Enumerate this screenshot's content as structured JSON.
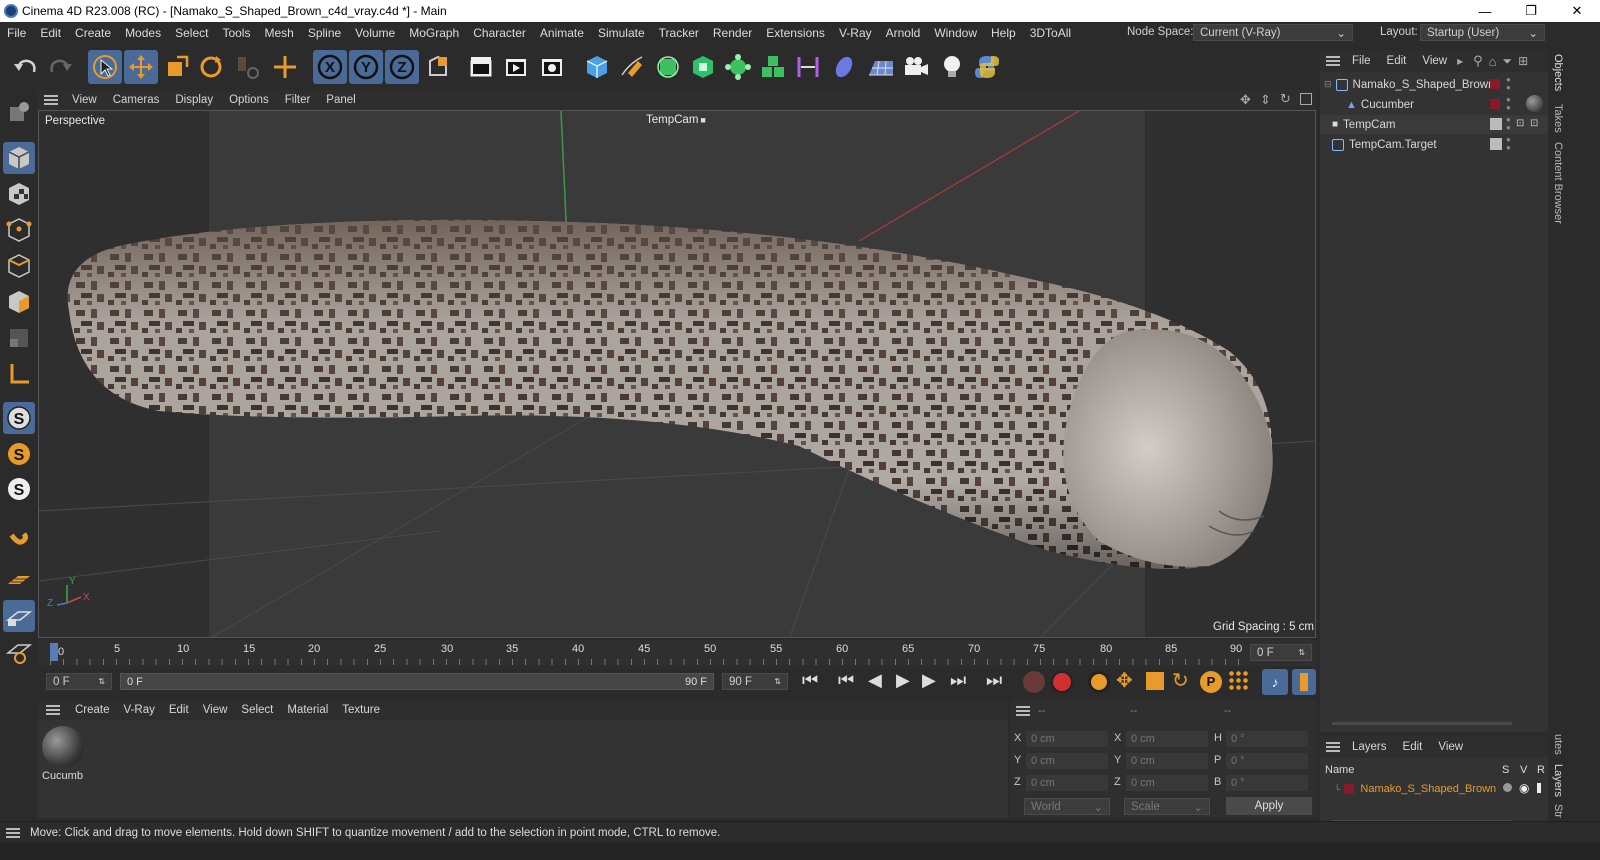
{
  "window": {
    "title": "Cinema 4D R23.008 (RC) - [Namako_S_Shaped_Brown_c4d_vray.c4d *] - Main",
    "minimize": "—",
    "restore": "❐",
    "close": "✕"
  },
  "menubar": {
    "items": [
      "File",
      "Edit",
      "Create",
      "Modes",
      "Select",
      "Tools",
      "Mesh",
      "Spline",
      "Volume",
      "MoGraph",
      "Character",
      "Animate",
      "Simulate",
      "Tracker",
      "Render",
      "Extensions",
      "V-Ray",
      "Arnold",
      "Window",
      "Help",
      "3DToAll"
    ],
    "node_space_label": "Node Space:",
    "node_space_value": "Current (V-Ray)",
    "layout_label": "Layout:",
    "layout_value": "Startup (User)"
  },
  "viewport": {
    "menu": [
      "View",
      "Cameras",
      "Display",
      "Options",
      "Filter",
      "Panel"
    ],
    "view_name": "Perspective",
    "camera_name": "TempCam",
    "grid_spacing": "Grid Spacing : 5 cm",
    "axis_y": "Y",
    "axis_z": "Z",
    "axis_x": "X"
  },
  "timeline": {
    "ticks": [
      "0",
      "5",
      "10",
      "15",
      "20",
      "25",
      "30",
      "35",
      "40",
      "45",
      "50",
      "55",
      "60",
      "65",
      "70",
      "75",
      "80",
      "85",
      "90"
    ],
    "current_frame": "0 F"
  },
  "transport": {
    "start_field": "0 F",
    "range_start": "0 F",
    "range_end": "90 F",
    "end_field": "90 F"
  },
  "material_manager": {
    "menu": [
      "Create",
      "V-Ray",
      "Edit",
      "View",
      "Select",
      "Material",
      "Texture"
    ],
    "materials": [
      {
        "name": "Cucumb"
      }
    ]
  },
  "coordinates": {
    "header": [
      "--",
      "--",
      "--"
    ],
    "rows": [
      {
        "a": "X",
        "av": "0 cm",
        "b": "X",
        "bv": "0 cm",
        "c": "H",
        "cv": "0 °"
      },
      {
        "a": "Y",
        "av": "0 cm",
        "b": "Y",
        "bv": "0 cm",
        "c": "P",
        "cv": "0 °"
      },
      {
        "a": "Z",
        "av": "0 cm",
        "b": "Z",
        "bv": "0 cm",
        "c": "B",
        "cv": "0 °"
      }
    ],
    "mode1": "World",
    "mode2": "Scale",
    "apply": "Apply"
  },
  "objects": {
    "menu": [
      "File",
      "Edit",
      "View"
    ],
    "items": [
      {
        "name": "Namako_S_Shaped_Brown",
        "indent": 0
      },
      {
        "name": "Cucumber",
        "indent": 1
      },
      {
        "name": "TempCam",
        "indent": 0
      },
      {
        "name": "TempCam.Target",
        "indent": 0
      }
    ]
  },
  "layers": {
    "menu": [
      "Layers",
      "Edit",
      "View"
    ],
    "col_name": "Name",
    "col_s": "S",
    "col_v": "V",
    "col_r": "R",
    "items": [
      {
        "name": "Namako_S_Shaped_Brown"
      }
    ]
  },
  "side_tabs": [
    "Objects",
    "Takes",
    "Content Browser",
    "utes",
    "Layers",
    "Str"
  ],
  "status": {
    "message": "Move: Click and drag to move elements. Hold down SHIFT to quantize movement / add to the selection in point mode, CTRL to remove."
  },
  "colors": {
    "accent": "#4a6a98",
    "orange": "#e89a2a",
    "layer_color": "#8a1a2a"
  }
}
